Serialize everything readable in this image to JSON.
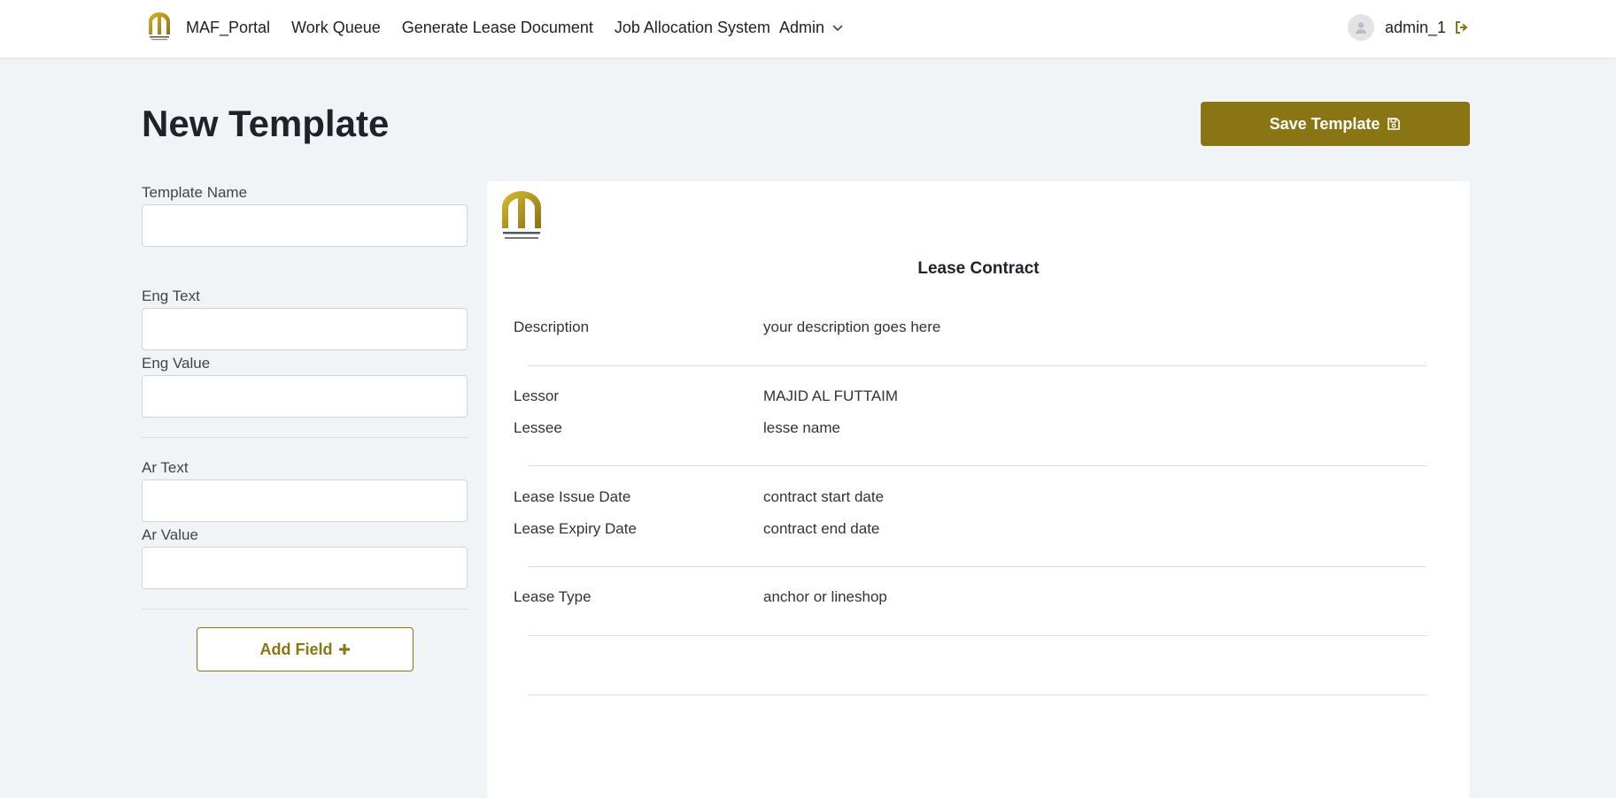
{
  "nav": {
    "brand": "MAF_Portal",
    "links": [
      "Work Queue",
      "Generate Lease Document",
      "Job Allocation System"
    ],
    "admin_label": "Admin",
    "username": "admin_1"
  },
  "page": {
    "title": "New Template",
    "save_label": "Save Template"
  },
  "form": {
    "template_name_label": "Template Name",
    "template_name_value": "",
    "eng_text_label": "Eng Text",
    "eng_text_value": "",
    "eng_value_label": "Eng Value",
    "eng_value_value": "",
    "ar_text_label": "Ar Text",
    "ar_text_value": "",
    "ar_value_label": "Ar Value",
    "ar_value_value": "",
    "add_field_label": "Add Field"
  },
  "preview": {
    "title": "Lease Contract",
    "rows": [
      {
        "label": "Description",
        "value": "your description goes here"
      },
      {
        "label": "Lessor",
        "value": "MAJID AL FUTTAIM"
      },
      {
        "label": "Lessee",
        "value": "lesse name"
      },
      {
        "label": "Lease Issue Date",
        "value": "contract start date"
      },
      {
        "label": "Lease Expiry Date",
        "value": "contract end date"
      },
      {
        "label": "Lease Type",
        "value": "anchor or lineshop"
      }
    ]
  },
  "colors": {
    "brand_gold": "#8a7515",
    "logo_gold": "#b89a1e",
    "background": "#f1f4f7"
  }
}
